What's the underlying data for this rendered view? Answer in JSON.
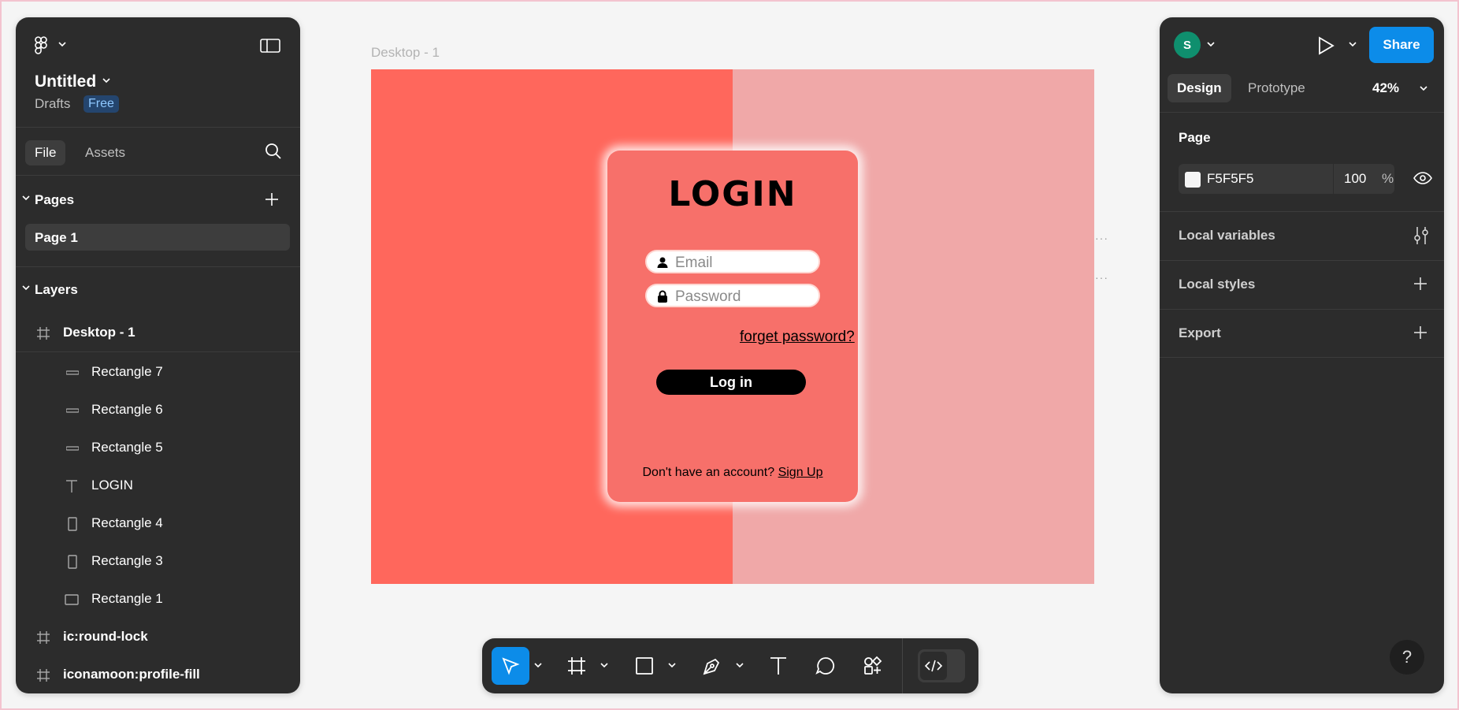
{
  "file": {
    "title": "Untitled",
    "location": "Drafts",
    "plan_badge": "Free"
  },
  "left_tabs": {
    "file": "File",
    "assets": "Assets"
  },
  "pages": {
    "header": "Pages",
    "items": [
      "Page 1"
    ]
  },
  "layers": {
    "header": "Layers",
    "items": [
      {
        "label": "Desktop - 1",
        "icon": "frame-icon"
      },
      {
        "label": "Rectangle 7",
        "icon": "line-icon"
      },
      {
        "label": "Rectangle 6",
        "icon": "line-icon"
      },
      {
        "label": "Rectangle 5",
        "icon": "line-icon"
      },
      {
        "label": "LOGIN",
        "icon": "text-icon"
      },
      {
        "label": "Rectangle 4",
        "icon": "rectangle-icon"
      },
      {
        "label": "Rectangle 3",
        "icon": "rectangle-icon"
      },
      {
        "label": "Rectangle 1",
        "icon": "rectangle-icon"
      },
      {
        "label": "ic:round-lock",
        "icon": "frame-icon"
      },
      {
        "label": "iconamoon:profile-fill",
        "icon": "frame-icon"
      }
    ]
  },
  "user": {
    "initial": "S"
  },
  "right_header": {
    "share_label": "Share"
  },
  "right_tabs": {
    "design": "Design",
    "prototype": "Prototype",
    "zoom": "42%"
  },
  "page_section": {
    "title": "Page",
    "fill_hex": "F5F5F5",
    "opacity": "100",
    "opacity_unit": "%"
  },
  "local_variables": {
    "title": "Local variables"
  },
  "local_styles": {
    "title": "Local styles"
  },
  "export": {
    "title": "Export"
  },
  "help": {
    "label": "?"
  },
  "canvas": {
    "frame_label": "Desktop - 1",
    "login_title": "LOGIN",
    "email_placeholder": "Email",
    "password_placeholder": "Password",
    "forget_password": "forget password?",
    "login_button": "Log in",
    "no_account_text": "Don't have an account?",
    "sign_up": "Sign Up"
  },
  "colors": {
    "panel_bg": "#2c2c2c",
    "canvas_bg": "#f5f5f5",
    "accent_blue": "#0c8ce9",
    "frame_left": "#ff675c",
    "frame_right": "#f0a8a8",
    "card": "#f7706a",
    "avatar": "#0f8f6e"
  }
}
